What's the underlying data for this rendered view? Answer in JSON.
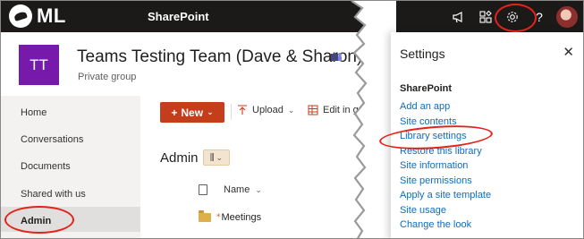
{
  "suite_bar": {
    "logo_text": "ML",
    "app_name": "SharePoint",
    "icons": [
      "megaphone-icon",
      "app-launcher-icon",
      "gear-icon",
      "help-icon",
      "user-avatar"
    ],
    "help_glyph": "?"
  },
  "site": {
    "logo_initials": "TT",
    "title": "Teams Testing Team (Dave & Sharon)",
    "subtitle": "Private group",
    "logo_color": "#7719aa"
  },
  "left_nav": {
    "items": [
      "Home",
      "Conversations",
      "Documents",
      "Shared with us",
      "Admin"
    ],
    "selected": "Admin"
  },
  "command_bar": {
    "new_label": "New",
    "upload_label": "Upload",
    "edit_label": "Edit in gri"
  },
  "library": {
    "title": "Admin",
    "column_name": "Name",
    "rows": [
      "Meetings"
    ]
  },
  "settings_panel": {
    "title": "Settings",
    "section": "SharePoint",
    "links": [
      "Add an app",
      "Site contents",
      "Library settings",
      "Restore this library",
      "Site information",
      "Site permissions",
      "Apply a site template",
      "Site usage",
      "Change the look"
    ],
    "close_glyph": "✕"
  },
  "colors": {
    "accent": "#c43e1c",
    "link": "#0f6cbd",
    "annotation": "#e32219",
    "suite_bar": "#1b1a19"
  }
}
